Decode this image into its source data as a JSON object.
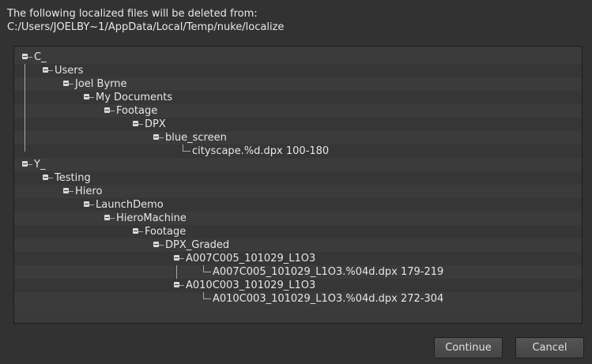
{
  "dialog": {
    "message_line1": "The following localized files will be deleted from:",
    "message_line2": "C:/Users/JOELBY~1/AppData/Local/Temp/nuke/localize",
    "continue_label": "Continue",
    "cancel_label": "Cancel"
  },
  "tree": {
    "items": [
      {
        "label": "C_",
        "expandable": true
      },
      {
        "label": "Users",
        "expandable": true
      },
      {
        "label": "Joel Byrne",
        "expandable": true
      },
      {
        "label": "My Documents",
        "expandable": true
      },
      {
        "label": "Footage",
        "expandable": true
      },
      {
        "label": "DPX",
        "expandable": true
      },
      {
        "label": "blue_screen",
        "expandable": true
      },
      {
        "label": "cityscape.%d.dpx 100-180",
        "expandable": false
      },
      {
        "label": "Y_",
        "expandable": true
      },
      {
        "label": "Testing",
        "expandable": true
      },
      {
        "label": "Hiero",
        "expandable": true
      },
      {
        "label": "LaunchDemo",
        "expandable": true
      },
      {
        "label": "HieroMachine",
        "expandable": true
      },
      {
        "label": "Footage",
        "expandable": true
      },
      {
        "label": "DPX_Graded",
        "expandable": true
      },
      {
        "label": "A007C005_101029_L1O3",
        "expandable": true
      },
      {
        "label": "A007C005_101029_L1O3.%04d.dpx 179-219",
        "expandable": false
      },
      {
        "label": "A010C003_101029_L1O3",
        "expandable": true
      },
      {
        "label": "A010C003_101029_L1O3.%04d.dpx 272-304",
        "expandable": false
      }
    ]
  }
}
